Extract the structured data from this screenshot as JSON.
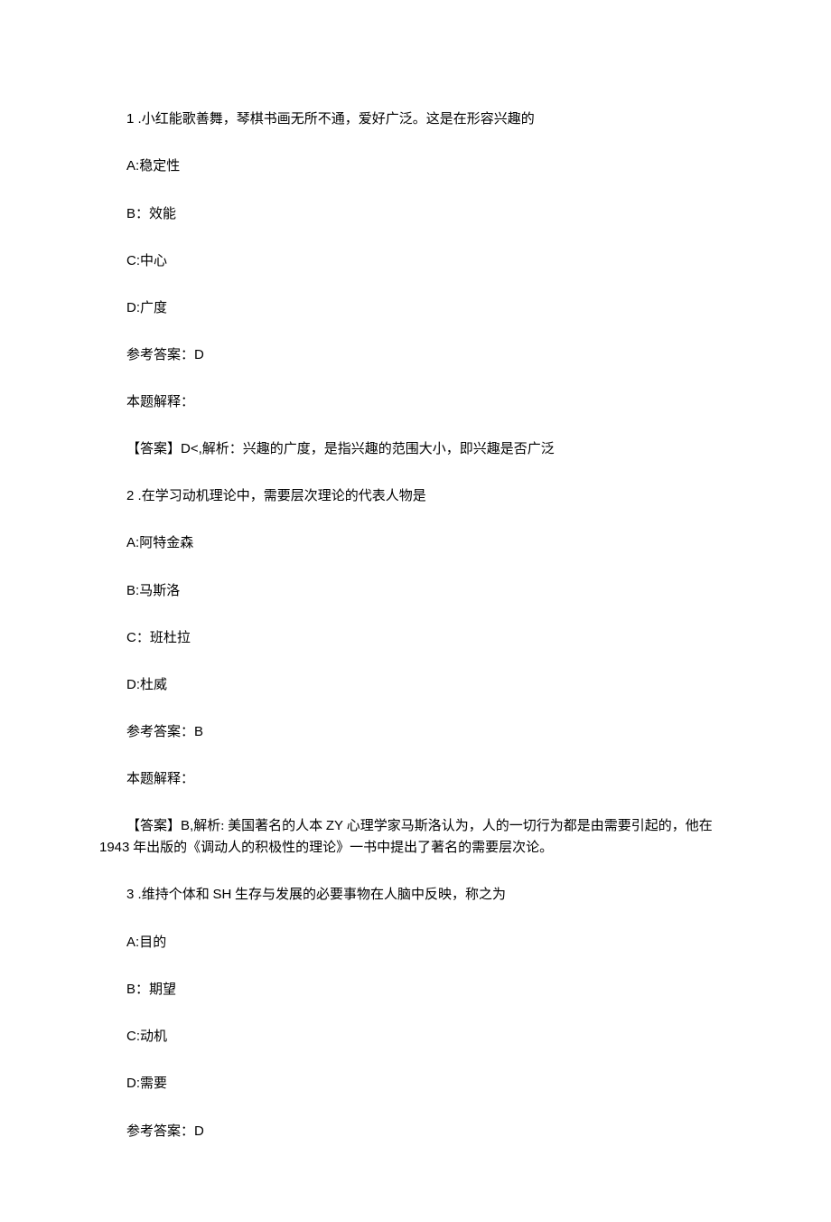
{
  "q1": {
    "number": "1",
    "dot": " .",
    "stem": "小红能歌善舞，琴棋书画无所不通，爱好广泛。这是在形容兴趣的",
    "optA_label": "A:",
    "optA_text": "稳定性",
    "optB_label": "B：",
    "optB_text": "效能",
    "optC_label": "C:",
    "optC_text": "中心",
    "optD_label": "D:",
    "optD_text": "广度",
    "ans_label": "参考答案：",
    "ans_value": "D",
    "exp_label": "本题解释：",
    "exp_prefix": "【答案】",
    "exp_letter": "D<,",
    "exp_body": "解析：兴趣的广度，是指兴趣的范围大小，即兴趣是否广泛"
  },
  "q2": {
    "number": "2",
    "dot": " .",
    "stem": "在学习动机理论中，需要层次理论的代表人物是",
    "optA_label": "A:",
    "optA_text": "阿特金森",
    "optB_label": "B:",
    "optB_text": "马斯洛",
    "optC_label": "C：",
    "optC_text": "班杜拉",
    "optD_label": "D:",
    "optD_text": "杜威",
    "ans_label": "参考答案：",
    "ans_value": "B",
    "exp_label": "本题解释：",
    "exp_prefix": "【答案】",
    "exp_letter": "B,",
    "exp_body_1": "解析: 美国著名的人本 ",
    "exp_body_latin": "ZY",
    "exp_body_2": " 心理学家马斯洛认为，人的一切行为都是由需要引起的，他在 ",
    "exp_body_year": "1943",
    "exp_body_3": " 年出版的《调动人的积极性的理论》一书中提出了著名的需要层次论。"
  },
  "q3": {
    "number": "3",
    "dot": " .",
    "stem_1": "维持个体和 ",
    "stem_latin": "SH",
    "stem_2": " 生存与发展的必要事物在人脑中反映，称之为",
    "optA_label": "A:",
    "optA_text": "目的",
    "optB_label": "B：",
    "optB_text": "期望",
    "optC_label": "C:",
    "optC_text": "动机",
    "optD_label": "D:",
    "optD_text": "需要",
    "ans_label": "参考答案：",
    "ans_value": "D"
  }
}
